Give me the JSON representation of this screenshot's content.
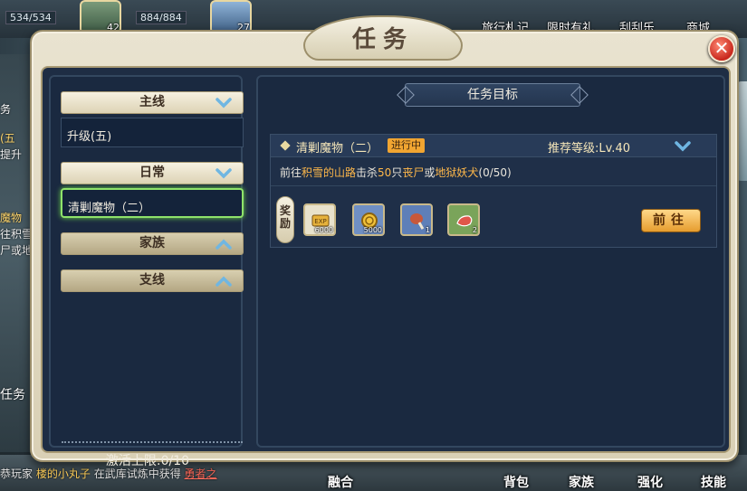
{
  "hud": {
    "hp1": "534/534",
    "hp2": "884/884",
    "level_badge_1": "42",
    "level_badge_2": "27",
    "top_buttons": [
      "旅行札记",
      "限时有礼",
      "刮刮乐",
      "商城"
    ],
    "left_partial": [
      "务",
      "(五",
      "提升",
      "魔物",
      "往积雪",
      "尸或地",
      "任务"
    ],
    "chat_line": {
      "prefix": "恭玩家",
      "player": "楼的小丸子",
      "middle": "在武库试炼中获得",
      "item": "勇者之"
    },
    "bottom_buttons": [
      "融合",
      "背包",
      "家族",
      "强化",
      "技能"
    ]
  },
  "dialog": {
    "title": "任务",
    "close_label": "✕",
    "categories": [
      {
        "label": "主线",
        "state": "open",
        "entries": [
          "升级(五)"
        ]
      },
      {
        "label": "日常",
        "state": "open",
        "entries": [
          "清剿魔物（二）"
        ]
      },
      {
        "label": "家族",
        "state": "closed",
        "entries": []
      },
      {
        "label": "支线",
        "state": "closed",
        "entries": []
      }
    ],
    "active_limit": "激活上限:0/10",
    "goal_header": "任务目标",
    "quest": {
      "name": "清剿魔物（二）",
      "status": "进行中",
      "recommended_level": "推荐等级:Lv.40",
      "desc_parts": [
        "前往",
        "积雪的山路",
        "击杀",
        "50",
        "只",
        "丧尸",
        "或",
        "地狱妖犬",
        "(0/50)"
      ],
      "reward_label": "奖励",
      "rewards": [
        {
          "name": "exp-scroll",
          "count": "6000",
          "bg": "#e8e2cc"
        },
        {
          "name": "gold-coin",
          "count": "5000",
          "bg": "#6f8fc4"
        },
        {
          "name": "meat-leg",
          "count": "1",
          "bg": "#5e7fb8"
        },
        {
          "name": "raw-meat",
          "count": "2",
          "bg": "#7aa45a"
        }
      ],
      "go_button": "前往"
    }
  },
  "colors": {
    "highlight": "#ffb84a",
    "selected_border": "#8fe36a",
    "status_badge": "#f1a531"
  }
}
